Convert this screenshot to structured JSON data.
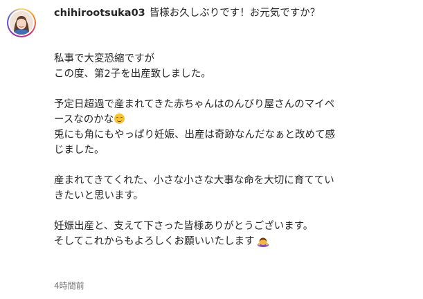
{
  "post": {
    "username": "chihirootsuka03",
    "caption_lines": [
      "皆様お久しぶりです！お元気ですか？",
      "私事で大変恐縮ですが",
      "この度、第2子を出産致しました。",
      "予定日超過で産まれてきた赤ちゃんはのんびり屋さんのマイペ",
      "ースなのかな",
      "兎にも角にもやっぱり妊娠、出産は奇跡なんだなぁと改めて感",
      "じました。",
      "産まれてきてくれた、小さな小さな大事な命を大切に育ててい",
      "きたいと思います。",
      "妊娠出産と、支えて下さった皆様ありがとうございます。",
      "そしてこれからもよろしくお願いいたします"
    ],
    "emojis": {
      "after_line_5": "smiling-face-emoji",
      "after_line_11": "person-bowing-emoji"
    },
    "timestamp": "4時間前"
  },
  "colors": {
    "text": "#262626",
    "muted": "#737373",
    "background": "#ffffff"
  }
}
